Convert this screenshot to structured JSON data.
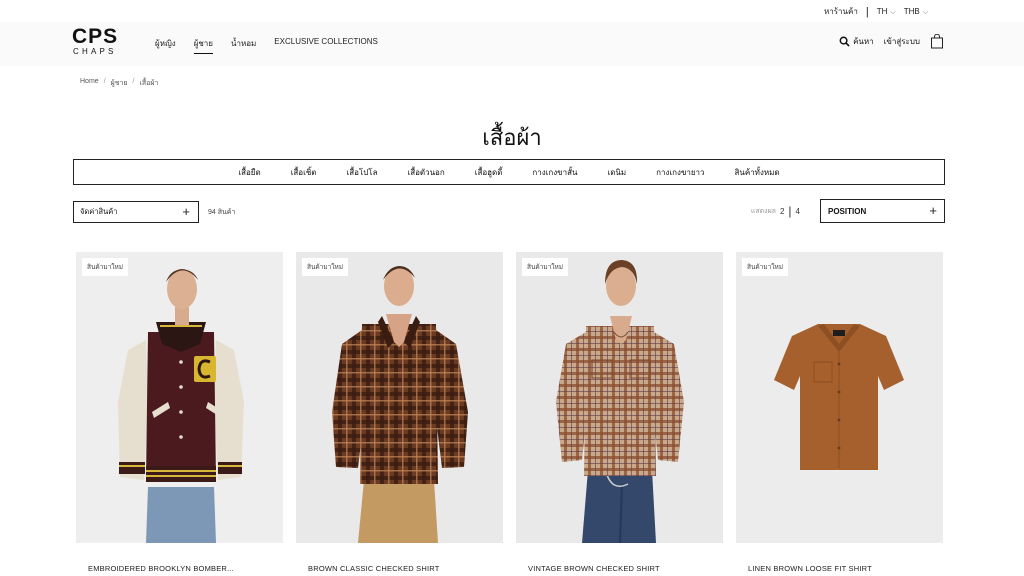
{
  "topbar": {
    "store_locator": "หาร้านค้า",
    "language": "TH",
    "currency": "THB"
  },
  "header": {
    "logo_top": "CPS",
    "logo_bottom": "CHAPS",
    "nav": [
      "ผู้หญิง",
      "ผู้ชาย",
      "น้ำหอม",
      "EXCLUSIVE COLLECTIONS"
    ],
    "active_nav": "ผู้ชาย",
    "search_label": "ค้นหา",
    "login_label": "เข้าสู่ระบบ"
  },
  "breadcrumb": [
    "Home",
    "ผู้ชาย",
    "เสื้อผ้า"
  ],
  "page_title": "เสื้อผ้า",
  "categories": [
    "เสื้อยืด",
    "เสื้อเชิ้ต",
    "เสื้อโปโล",
    "เสื้อตัวนอก",
    "เสื้อฮูดดี้",
    "กางเกงขาสั้น",
    "เดนิม",
    "กางเกงขายาว",
    "สินค้าทั้งหมด"
  ],
  "filter": {
    "sort_label": "จัดค่าสินค้า",
    "count": "94 สินค้า",
    "view_label": "แสดงผล",
    "view_options": [
      "2",
      "4"
    ],
    "position_label": "POSITION"
  },
  "products": [
    {
      "badge": "สินค้ามาใหม่",
      "name": "EMBROIDERED BROOKLYN BOMBER..."
    },
    {
      "badge": "สินค้ามาใหม่",
      "name": "BROWN CLASSIC CHECKED SHIRT"
    },
    {
      "badge": "สินค้ามาใหม่",
      "name": "VINTAGE BROWN CHECKED SHIRT"
    },
    {
      "badge": "สินค้ามาใหม่",
      "name": "LINEN BROWN LOOSE FIT SHIRT"
    }
  ],
  "colors": {
    "text": "#111111",
    "header_bg": "#fafafa",
    "product_bg": "#ececec"
  }
}
